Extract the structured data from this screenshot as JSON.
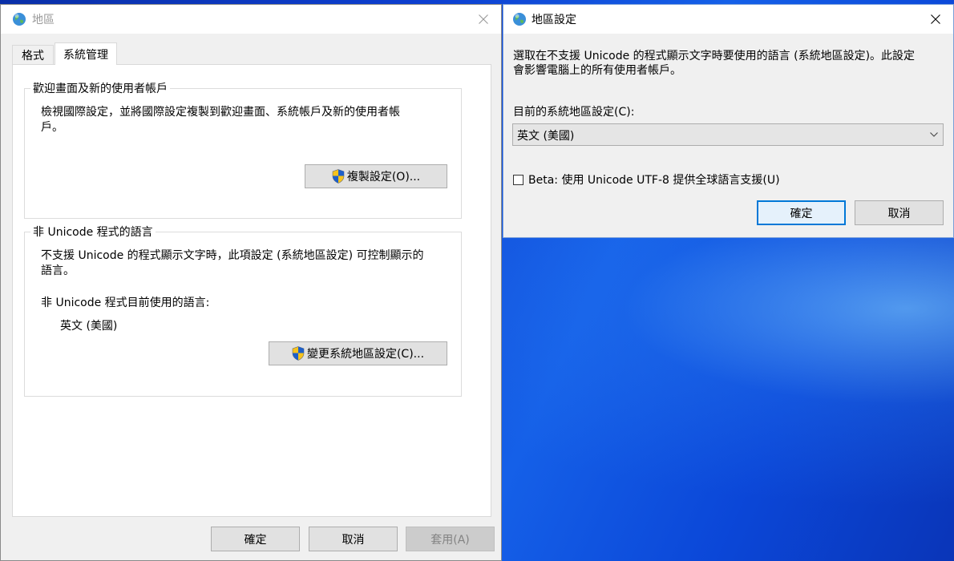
{
  "region_window": {
    "title": "地區",
    "tabs": [
      {
        "label": "格式",
        "active": false
      },
      {
        "label": "系統管理",
        "active": true
      }
    ],
    "welcome_group": {
      "legend": "歡迎畫面及新的使用者帳戶",
      "description_line1": "檢視國際設定，並將國際設定複製到歡迎畫面、系統帳戶及新的使用者帳",
      "description_line2": "戶。",
      "copy_button": "複製設定(O)..."
    },
    "non_unicode_group": {
      "legend": "非 Unicode 程式的語言",
      "description_line1": "不支援 Unicode 的程式顯示文字時，此項設定 (系統地區設定) 可控制顯示的",
      "description_line2": "語言。",
      "current_label": "非 Unicode 程式目前使用的語言:",
      "current_value": "英文 (美國)",
      "change_button": "變更系統地區設定(C)..."
    },
    "buttons": {
      "ok": "確定",
      "cancel": "取消",
      "apply": "套用(A)"
    }
  },
  "locale_dialog": {
    "title": "地區設定",
    "description_line1": "選取在不支援 Unicode 的程式顯示文字時要使用的語言 (系統地區設定)。此設定",
    "description_line2": "會影響電腦上的所有使用者帳戶。",
    "current_label": "目前的系統地區設定(C):",
    "select_value": "英文 (美國)",
    "beta_checkbox_label": "Beta: 使用 Unicode UTF-8 提供全球語言支援(U)",
    "beta_checked": false,
    "buttons": {
      "ok": "確定",
      "cancel": "取消"
    }
  },
  "icons": {
    "app": "globe-icon",
    "uac": "uac-shield-icon",
    "close": "close-icon",
    "dropdown": "chevron-down-icon"
  },
  "colors": {
    "accent": "#0078d7",
    "desktop": "#0d3fd0"
  }
}
